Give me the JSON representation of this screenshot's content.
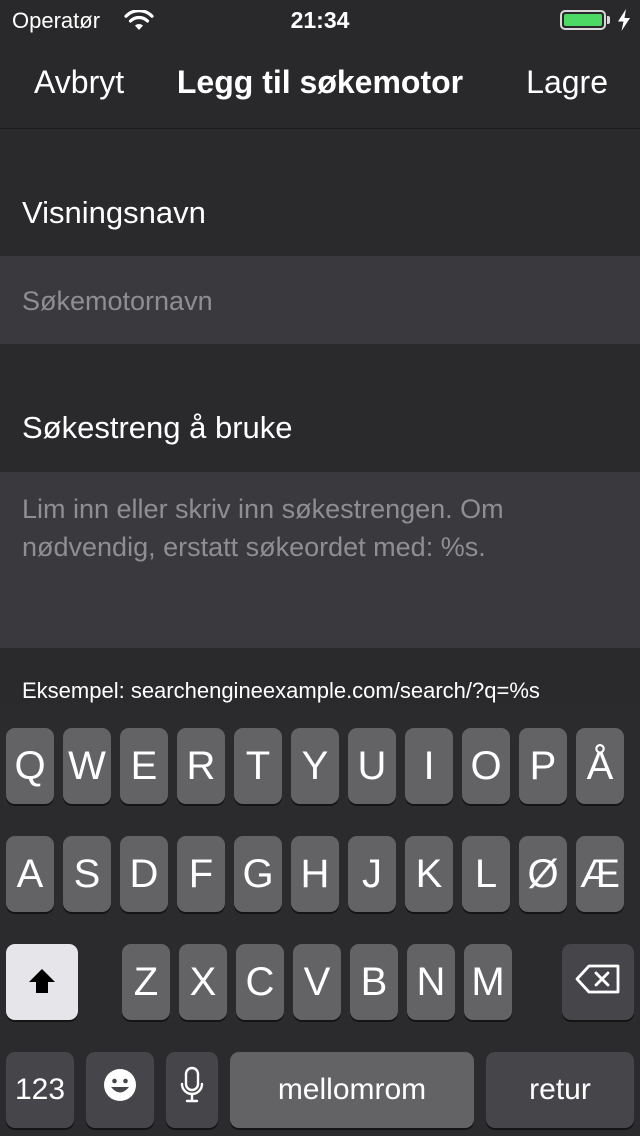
{
  "status_bar": {
    "carrier": "Operatør",
    "time": "21:34",
    "battery_level": 1.0,
    "battery_color": "#4cd964",
    "icons": [
      "wifi-icon",
      "battery-icon",
      "charging-bolt-icon"
    ]
  },
  "navbar": {
    "cancel_label": "Avbryt",
    "title": "Legg til søkemotor",
    "save_label": "Lagre"
  },
  "form": {
    "name_label": "Visningsnavn",
    "name_placeholder": "Søkemotornavn",
    "query_label": "Søkestreng å bruke",
    "query_placeholder_line1": "Lim inn eller skriv inn søkestrengen. Om",
    "query_placeholder_line2": "nødvendig, erstatt søkeordet med: %s.",
    "example_text": "Eksempel: searchengineexample.com/search/?q=%s"
  },
  "keyboard": {
    "row1": [
      "Q",
      "W",
      "E",
      "R",
      "T",
      "Y",
      "U",
      "I",
      "O",
      "P",
      "Å"
    ],
    "row2": [
      "A",
      "S",
      "D",
      "F",
      "G",
      "H",
      "J",
      "K",
      "L",
      "Ø",
      "Æ"
    ],
    "row3": [
      "Z",
      "X",
      "C",
      "V",
      "B",
      "N",
      "M"
    ],
    "numbers_label": "123",
    "space_label": "mellomrom",
    "return_label": "retur",
    "icons": [
      "shift-icon",
      "backspace-icon",
      "emoji-icon",
      "microphone-icon"
    ]
  }
}
